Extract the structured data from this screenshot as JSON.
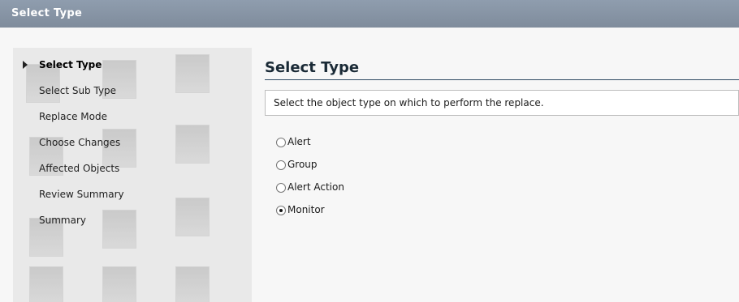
{
  "window": {
    "title": "Select Type"
  },
  "wizard_steps": [
    {
      "label": "Select Type",
      "current": true
    },
    {
      "label": "Select Sub Type",
      "current": false
    },
    {
      "label": "Replace Mode",
      "current": false
    },
    {
      "label": "Choose Changes",
      "current": false
    },
    {
      "label": "Affected Objects",
      "current": false
    },
    {
      "label": "Review Summary",
      "current": false
    },
    {
      "label": "Summary",
      "current": false
    }
  ],
  "content": {
    "heading": "Select Type",
    "description": "Select the object type on which to perform the replace.",
    "options": [
      {
        "label": "Alert",
        "selected": false
      },
      {
        "label": "Group",
        "selected": false
      },
      {
        "label": "Alert Action",
        "selected": false
      },
      {
        "label": "Monitor",
        "selected": true
      }
    ]
  }
}
